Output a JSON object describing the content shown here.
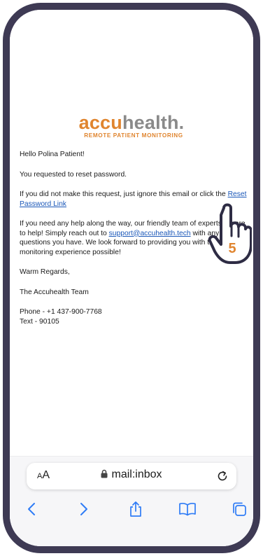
{
  "logo": {
    "part1": "accu",
    "part2": "health.",
    "tagline": "REMOTE PATIENT MONITORING"
  },
  "email": {
    "greeting": "Hello Polina Patient!",
    "request_line": "You requested to reset password.",
    "ignore_prefix": "If you did not make this request, just ignore this email or click the ",
    "reset_link": "Reset Password Link",
    "help_text_1": "If you need any help along the way, our friendly team of experts is here to help! Simply reach out to ",
    "support_email": "support@accuhealth.tech",
    "help_text_2": " with any questions you have. We look forward to providing you with the best monitoring experience possible!",
    "regards": "Warm Regards,",
    "team": "The Accuhealth Team",
    "phone": "Phone - +1 437-900-7768",
    "text": "Text - 90105"
  },
  "cursor": {
    "step_number": "5"
  },
  "browser": {
    "text_size_label_small": "A",
    "text_size_label_large": "A",
    "url": "mail:inbox"
  },
  "icons": {
    "lock": "lock-icon",
    "reload": "reload-icon",
    "back": "chevron-left-icon",
    "forward": "chevron-right-icon",
    "share": "share-icon",
    "bookmarks": "book-icon",
    "tabs": "tabs-icon"
  },
  "colors": {
    "frame": "#3e3a54",
    "brand_orange": "#e0852f",
    "link": "#1a57b8",
    "ios_blue": "#2f7cf6"
  }
}
